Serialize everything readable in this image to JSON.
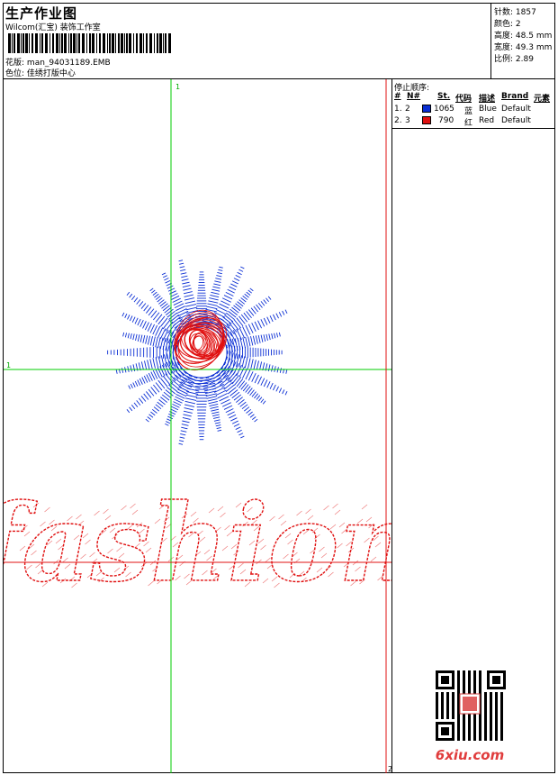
{
  "header": {
    "title": "生产作业图",
    "subtitle": "Wilcom(汇宝) 装饰工作室",
    "design_label": "花版:",
    "design_value": "man_94031189.EMB",
    "color_label": "色位:",
    "color_value": "佳绣打版中心"
  },
  "stats": [
    {
      "label": "针数:",
      "value": "1857"
    },
    {
      "label": "颜色:",
      "value": "2"
    },
    {
      "label": "高度:",
      "value": "48.5 mm"
    },
    {
      "label": "宽度:",
      "value": "49.3 mm"
    },
    {
      "label": "比例:",
      "value": "2.89"
    }
  ],
  "stop_sequence": {
    "title": "停止顺序:",
    "columns": [
      "#",
      "N#",
      "St.",
      "代码",
      "描述",
      "Brand",
      "元素"
    ],
    "rows": [
      {
        "index": "1.",
        "needle": "2",
        "color": "#0a2ed4",
        "stitches": "1065",
        "code": "蓝",
        "desc": "Blue",
        "brand": "Default"
      },
      {
        "index": "2.",
        "needle": "3",
        "color": "#e01010",
        "stitches": "790",
        "code": "红",
        "desc": "Red",
        "brand": "Default"
      }
    ]
  },
  "canvas": {
    "embroidery_text": "fashion",
    "guide_markers": {
      "top": "1",
      "left": "1",
      "bottom_right": "2"
    },
    "thread_colors": {
      "blue": "#0a2ed4",
      "red": "#e01010",
      "guide_green": "#00cc00",
      "guide_red": "#e01010"
    }
  },
  "watermark": {
    "brand": "6xiu.com",
    "qr_stamp": "佳绣打版中心"
  }
}
